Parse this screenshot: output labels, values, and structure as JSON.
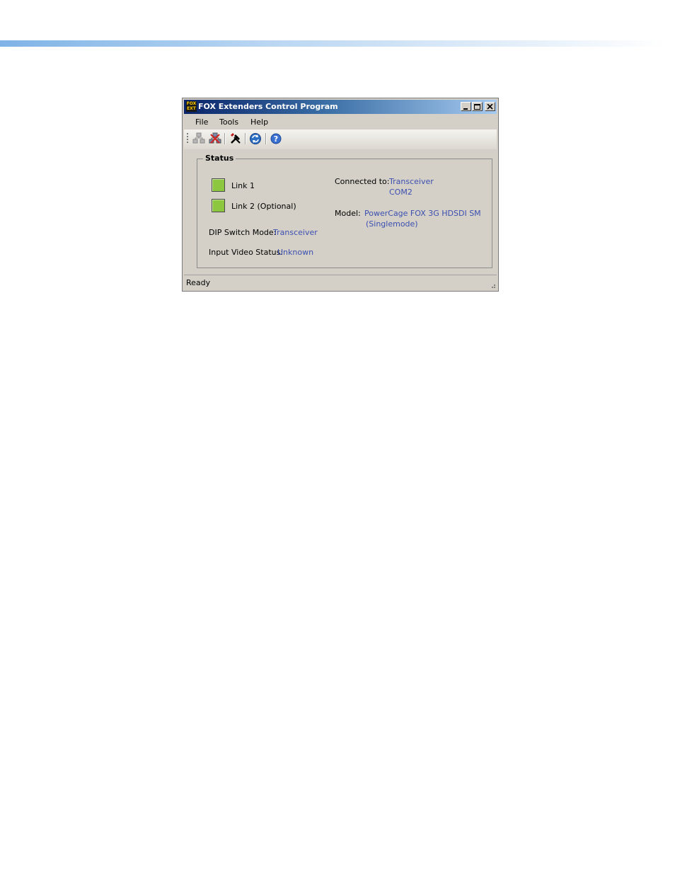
{
  "window": {
    "title": "FOX Extenders Control Program",
    "icon_text": [
      "FOX",
      "EXT"
    ]
  },
  "menu": {
    "items": [
      "File",
      "Tools",
      "Help"
    ]
  },
  "toolbar": {
    "icons": [
      "connect-icon",
      "disconnect-icon",
      "tools-icon",
      "refresh-icon",
      "help-icon"
    ]
  },
  "status_group": {
    "title": "Status",
    "link1_label": "Link 1",
    "link2_label": "Link 2  (Optional)",
    "link_color": "#8dc63f",
    "dip_label": "DIP Switch Mode:",
    "dip_value": "Transceiver",
    "input_label": "Input Video Status:",
    "input_value": "Unknown",
    "connected_label": "Connected to:",
    "connected_value1": "Transceiver",
    "connected_value2": "COM2",
    "model_label": "Model:",
    "model_value1": "PowerCage FOX 3G HDSDI SM",
    "model_value2": "(Singlemode)"
  },
  "statusbar": {
    "text": "Ready"
  }
}
